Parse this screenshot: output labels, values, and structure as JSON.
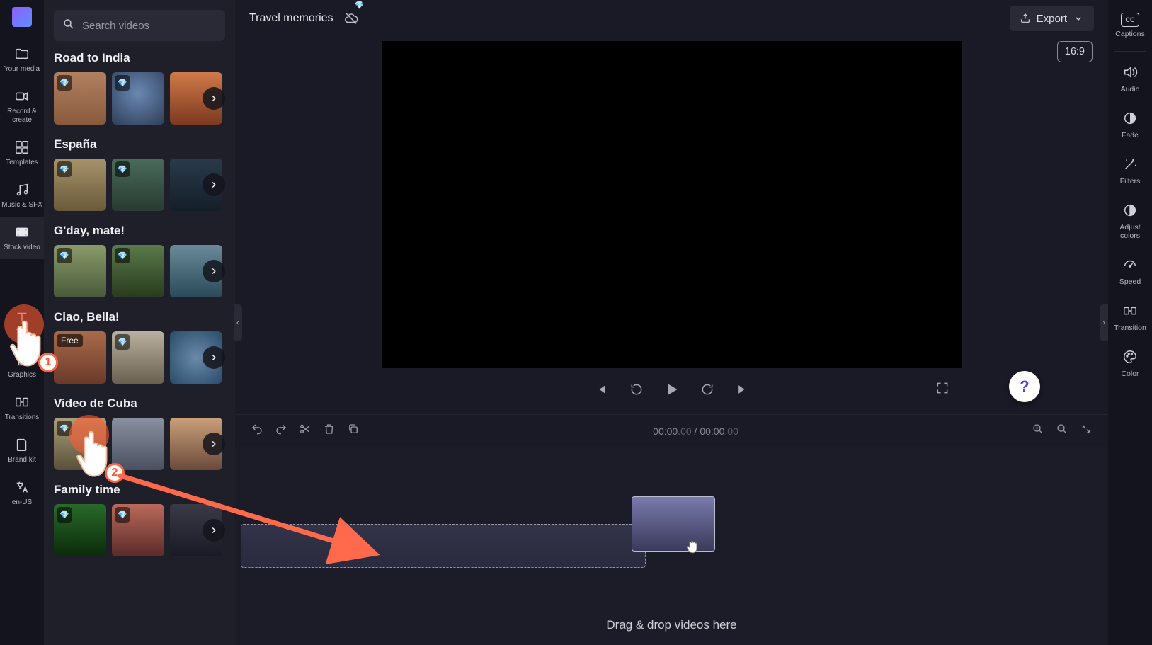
{
  "leftRail": {
    "items": [
      {
        "label": "Your media"
      },
      {
        "label": "Record & create"
      },
      {
        "label": "Templates"
      },
      {
        "label": "Music & SFX"
      },
      {
        "label": "Stock video"
      },
      {
        "label": "Text"
      },
      {
        "label": "Graphics"
      },
      {
        "label": "Transitions"
      },
      {
        "label": "Brand kit"
      },
      {
        "label": "en-US"
      }
    ]
  },
  "search": {
    "placeholder": "Search videos"
  },
  "categories": [
    {
      "title": "Road to India"
    },
    {
      "title": "España"
    },
    {
      "title": "G'day, mate!"
    },
    {
      "title": "Ciao, Bella!"
    },
    {
      "title": "Video de Cuba"
    },
    {
      "title": "Family time"
    }
  ],
  "freeBadge": "Free",
  "project": {
    "title": "Travel memories"
  },
  "export": {
    "label": "Export"
  },
  "aspect": "16:9",
  "timecode": {
    "current": "00:00",
    "currentMs": ".00",
    "sep": " / ",
    "total": "00:00",
    "totalMs": ".00"
  },
  "dropText": "Drag & drop videos here",
  "rightRail": {
    "items": [
      {
        "label": "Captions"
      },
      {
        "label": "Audio"
      },
      {
        "label": "Fade"
      },
      {
        "label": "Filters"
      },
      {
        "label": "Adjust colors"
      },
      {
        "label": "Speed"
      },
      {
        "label": "Transition"
      },
      {
        "label": "Color"
      }
    ]
  },
  "cc": "CC",
  "annotation": {
    "badge1": "1",
    "badge2": "2"
  }
}
